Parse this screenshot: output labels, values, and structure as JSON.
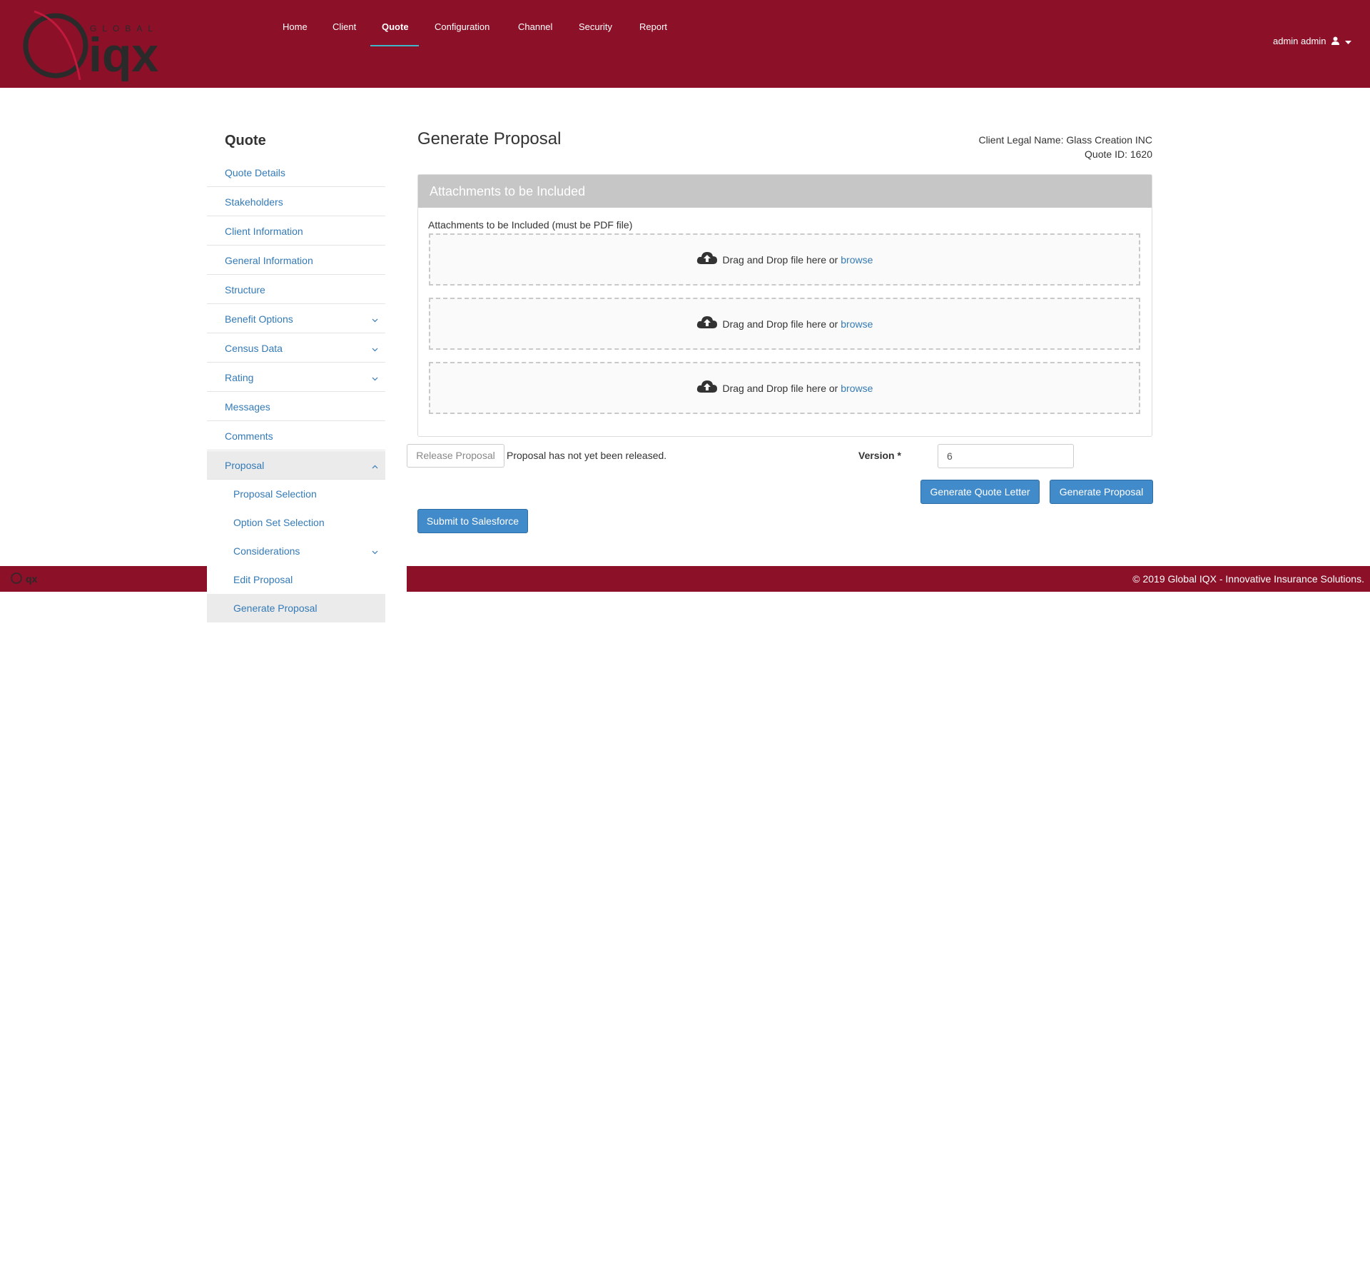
{
  "header": {
    "logo": {
      "top_text": "GLOBAL",
      "main_text": "iqx",
      "alt": "Global IQX logo"
    },
    "nav": [
      {
        "label": "Home"
      },
      {
        "label": "Client"
      },
      {
        "label": "Quote",
        "active": true
      },
      {
        "label": "Configuration"
      },
      {
        "label": "Channel"
      },
      {
        "label": "Security"
      },
      {
        "label": "Report"
      }
    ],
    "user": {
      "name": "admin admin",
      "icon": "user-icon",
      "caret": "caret-down-icon"
    }
  },
  "sidebar": {
    "title": "Quote",
    "items": [
      {
        "label": "Quote Details"
      },
      {
        "label": "Stakeholders"
      },
      {
        "label": "Client Information"
      },
      {
        "label": "General Information"
      },
      {
        "label": "Structure"
      },
      {
        "label": "Benefit Options",
        "chevron": "down"
      },
      {
        "label": "Census Data",
        "chevron": "down"
      },
      {
        "label": "Rating",
        "chevron": "down"
      },
      {
        "label": "Messages"
      },
      {
        "label": "Comments"
      },
      {
        "label": "Proposal",
        "chevron": "up",
        "expanded": true
      },
      {
        "label": "Proposal Selection",
        "sub": true
      },
      {
        "label": "Option Set Selection",
        "sub": true
      },
      {
        "label": "Considerations",
        "sub": true,
        "chevron": "down"
      },
      {
        "label": "Edit Proposal",
        "sub": true
      },
      {
        "label": "Generate Proposal",
        "sub": true,
        "selected": true
      }
    ]
  },
  "main": {
    "title": "Generate Proposal",
    "client_legal_name": "Client Legal Name: Glass Creation INC",
    "quote_id": "Quote ID: 1620",
    "panel": {
      "heading": "Attachments to be Included",
      "label": "Attachments to be Included (must be PDF file)",
      "dropzones": [
        {
          "text": "Drag and Drop file here or",
          "link": "browse",
          "icon": "cloud-upload-icon"
        },
        {
          "text": "Drag and Drop file here or",
          "link": "browse",
          "icon": "cloud-upload-icon"
        },
        {
          "text": "Drag and Drop file here or",
          "link": "browse",
          "icon": "cloud-upload-icon"
        }
      ]
    },
    "release_button": "Release Proposal",
    "release_status": "Proposal has not yet been released.",
    "version_label": "Version *",
    "version_value": "6",
    "generate_quote_letter": "Generate Quote Letter",
    "generate_proposal": "Generate Proposal",
    "submit_salesforce": "Submit to Salesforce"
  },
  "footer": {
    "logo_text": "qx",
    "copyright": "© 2019 Global IQX - Innovative Insurance Solutions."
  },
  "colors": {
    "brand": "#8b1028",
    "link": "#337ab7",
    "primary_button": "#428bca",
    "active_underline": "#3fb6c8",
    "panel_heading": "#c6c6c6"
  }
}
